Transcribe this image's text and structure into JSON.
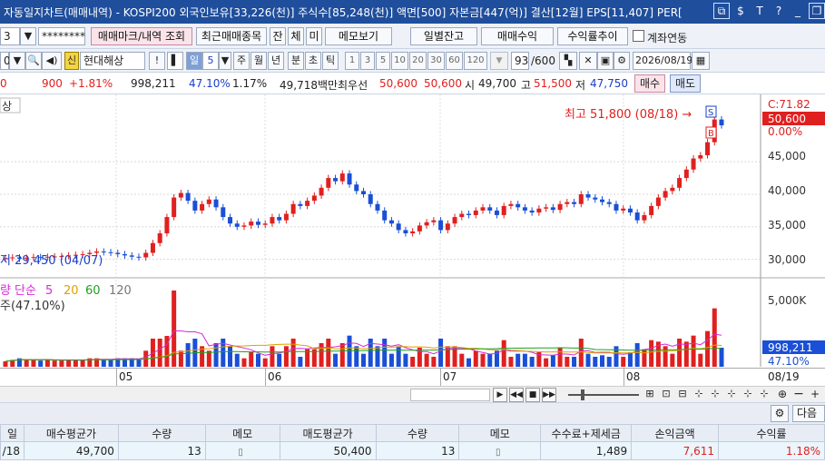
{
  "window": {
    "title": "자동일지차트(매매내역) - KOSPI200 외국인보유[33,226(천)] 주식수[85,248(천)] 액면[500] 자본금[447(억)] 결산[12월] EPS[11,407] PER["
  },
  "toolbar1": {
    "account_fragment": "3",
    "password_mask": "********",
    "btn_trade_mark": "매매마크/내역 조회",
    "btn_recent_items": "최근매매종목",
    "btn_jan": "잔",
    "btn_che": "체",
    "btn_mi": "미",
    "btn_memo": "메모보기",
    "btn_daily_balance": "일별잔고",
    "btn_trade_profit": "매매수익",
    "btn_return_trend": "수익률추이",
    "chk_account_link": "계좌연동"
  },
  "toolbar2": {
    "code_fragment": "0",
    "stock_badge": "신",
    "stock_name": "현대해상",
    "period_day": "일",
    "period_count": "5",
    "period_week": "주",
    "period_month": "월",
    "period_year": "년",
    "period_min": "분",
    "period_sec": "초",
    "period_tick": "틱",
    "intervals": [
      "1",
      "3",
      "5",
      "10",
      "20",
      "30",
      "60",
      "120"
    ],
    "count_value": "93",
    "count_total": "/600",
    "date": "2026/08/19"
  },
  "ticker": {
    "price_fragment": "0",
    "change": "900",
    "change_pct": "+1.81%",
    "volume": "998,211",
    "vol_ratio": "47.10%",
    "turnover": "1.17%",
    "amount": "49,718백만",
    "priority_label": "최우선",
    "ask": "50,600",
    "bid": "50,600",
    "open_label": "시",
    "open": "49,700",
    "high_label": "고",
    "high": "51,500",
    "low_label": "저",
    "low": "47,750",
    "buy_label": "매수",
    "sell_label": "매도"
  },
  "chart": {
    "legend_fragment": "상",
    "high_annotation": "최고 51,800 (08/18) →",
    "low_annotation": "저 29,450 (04/07)",
    "current_price": "50,600",
    "current_change": "0.00%",
    "top_label": "C:71.82",
    "price_ticks": [
      "45,000",
      "40,000",
      "35,000",
      "30,000"
    ],
    "volume_legend": {
      "prefix": "량",
      "ma_label": "단순",
      "ma_periods": [
        "5",
        "20",
        "60",
        "120"
      ],
      "ma_colors": [
        "#d52ad6",
        "#e0a000",
        "#1fa01f",
        "#777777"
      ],
      "sub_label": "주(47.10%)"
    },
    "volume_tick": "5,000K",
    "volume_value": "998,211",
    "volume_pct": "47.10%",
    "x_months": [
      "05",
      "06",
      "07",
      "08"
    ],
    "x_last_date": "08/19",
    "buy_marker": "S",
    "sell_marker": "B",
    "up_color": "#e0201f",
    "down_color": "#1a4fd6"
  },
  "chart_data": {
    "type": "candlestick",
    "series": [
      {
        "name": "price",
        "values": [
          30200,
          30300,
          30100,
          30250,
          30350,
          30300,
          30400,
          30450,
          30500,
          30600,
          30700,
          30800,
          31000,
          31200,
          31100,
          31000,
          30800,
          30600,
          30400,
          30300,
          31000,
          32500,
          34000,
          36500,
          39500,
          40200,
          39000,
          37500,
          38500,
          39200,
          38000,
          36500,
          35500,
          35000,
          35200,
          35800,
          35300,
          35500,
          36500,
          36000,
          37000,
          38500,
          38200,
          39000,
          39800,
          41000,
          42500,
          42000,
          43200,
          41500,
          40500,
          40000,
          38500,
          37500,
          36000,
          35500,
          34500,
          34000,
          34300,
          35200,
          35700,
          36000,
          34500,
          35500,
          36500,
          37000,
          36800,
          37500,
          38000,
          37500,
          36800,
          38200,
          38500,
          38000,
          37500,
          37200,
          37800,
          38000,
          37600,
          38500,
          38800,
          38500,
          40000,
          39500,
          39200,
          38800,
          38500,
          37500,
          37800,
          37200,
          36000,
          36800,
          38200,
          39500,
          40500,
          41000,
          42500,
          43800,
          45500,
          46000,
          48000,
          51500,
          50600
        ]
      }
    ],
    "volume_series": {
      "name": "volume",
      "unit": "K"
    },
    "ylim": [
      28000,
      52000
    ],
    "volume_max": 5000
  },
  "table": {
    "headers": [
      "일",
      "매수평균가",
      "수량",
      "메모",
      "매도평균가",
      "수량",
      "메모",
      "수수료+제세금",
      "손익금액",
      "수익률"
    ],
    "row": [
      "/18",
      "49,700",
      "13",
      "",
      "50,400",
      "13",
      "",
      "1,489",
      "7,611",
      "1.18%"
    ]
  },
  "gridtools": {
    "next_label": "다음"
  }
}
